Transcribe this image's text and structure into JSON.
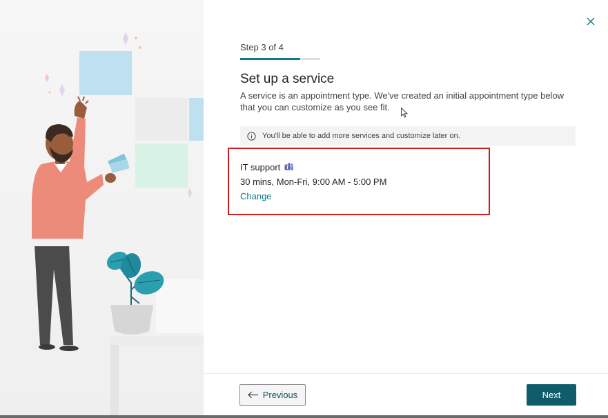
{
  "wizard": {
    "step_label": "Step 3 of 4",
    "progress_fraction": 0.75,
    "title": "Set up a service",
    "description": "A service is an appointment type. We've created an initial appointment type below that you can customize as you see fit.",
    "info_message": "You'll be able to add more services and customize later on.",
    "service": {
      "name": "IT support",
      "details": "30 mins, Mon-Fri, 9:00 AM - 5:00 PM",
      "change_label": "Change"
    },
    "buttons": {
      "previous_label": "Previous",
      "next_label": "Next"
    }
  },
  "icons": {
    "close": "close-icon",
    "info": "info-icon",
    "teams": "teams-icon",
    "arrow_left": "arrow-left-icon",
    "cursor": "mouse-cursor-icon"
  },
  "colors": {
    "accent": "#0e7a8a",
    "primary_button": "#0f5d6b",
    "highlight_border": "#d01c1c"
  }
}
